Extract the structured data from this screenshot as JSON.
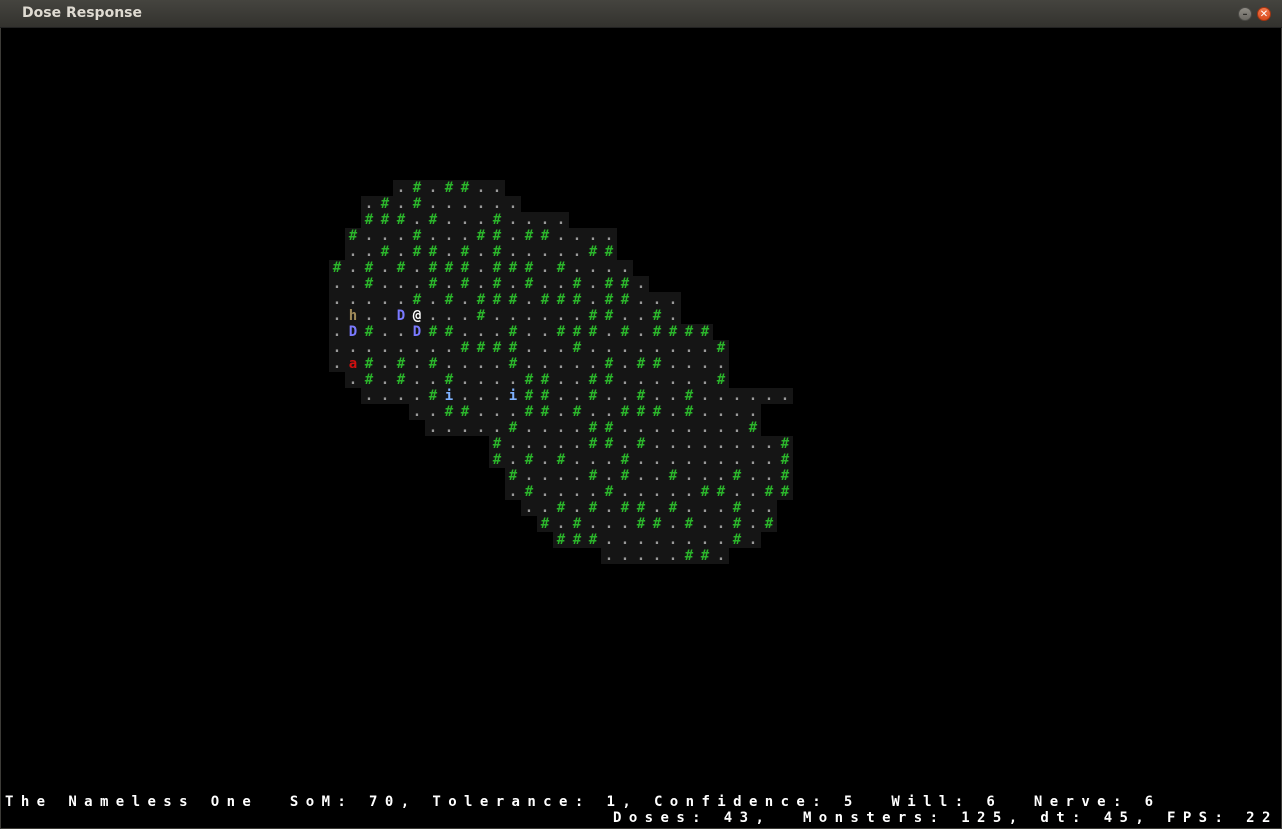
{
  "window": {
    "title": "Dose Response",
    "minimize_icon": "minus-icon",
    "close_icon": "close-icon"
  },
  "colors": {
    "background": "#000000",
    "floor": "#151515",
    "wall_green": "#2bb52b",
    "floor_dot": "#9a9a9a",
    "player": "#ffffff",
    "monster_D": "#7a7aff",
    "monster_h": "#a08b5a",
    "monster_i": "#7fb2ff",
    "monster_a": "#d01010"
  },
  "map": {
    "origin_col": 20,
    "origin_row": 7,
    "rows": [
      {
        "row": 9,
        "start": 24,
        "text": ". # . # # . ."
      },
      {
        "row": 10,
        "start": 22,
        "text": ". # . # . . . . . ."
      },
      {
        "row": 11,
        "start": 22,
        "text": "# # # . # . . . # . . . ."
      },
      {
        "row": 12,
        "start": 21,
        "text": "# . . . # . . . # # . # # . . . ."
      },
      {
        "row": 13,
        "start": 21,
        "text": ". . # . # # . # . # . . . . . # #"
      },
      {
        "row": 14,
        "start": 20,
        "text": "# . # . # . # # # . # # # . # . . . ."
      },
      {
        "row": 15,
        "start": 20,
        "text": ". . # . . . # . # . # . # . . # . # # ."
      },
      {
        "row": 16,
        "start": 20,
        "text": ". . . . . # . # . # # # . # # # . # # . . ."
      },
      {
        "row": 17,
        "start": 20,
        "text": ". h . . D @ . . . # . . . . . . # # . . # ."
      },
      {
        "row": 18,
        "start": 20,
        "text": ". D # . . D # # . . . # . . # # # . # . # # # #"
      },
      {
        "row": 19,
        "start": 20,
        "text": ". . . . . . . . # # # # . . . # . . . . . . . . #"
      },
      {
        "row": 20,
        "start": 20,
        "text": ". a # . # . # . . . . # . . . . . # . # # . . . ."
      },
      {
        "row": 21,
        "start": 21,
        "text": ". # . # . . # . . . . # # . . # # . . . . . . #"
      },
      {
        "row": 22,
        "start": 22,
        "text": ". . . . # i . . . i # # . . # . . # . . # . . . . . ."
      },
      {
        "row": 23,
        "start": 25,
        "text": ". . # # . . . # # . # . . # # # . # . . . ."
      },
      {
        "row": 24,
        "start": 26,
        "text": ". . . . . # . . . . # # . . . . . . . . #"
      },
      {
        "row": 25,
        "start": 30,
        "text": "# . . . . . # # . # . . . . . . . . #"
      },
      {
        "row": 26,
        "start": 30,
        "text": "# . # . # . . . # . . . . . . . . . #"
      },
      {
        "row": 27,
        "start": 31,
        "text": "# . . . . # . # . . # . . . # . . #"
      },
      {
        "row": 28,
        "start": 31,
        "text": ". # . . . . # . . . . . # # . . # #"
      },
      {
        "row": 29,
        "start": 32,
        "text": ". . # . # . # # . # . . . # . ."
      },
      {
        "row": 30,
        "start": 33,
        "text": "# . # . . . # # . # . . # . #"
      },
      {
        "row": 31,
        "start": 34,
        "text": "# # # . . . . . . . . # ."
      },
      {
        "row": 32,
        "start": 37,
        "text": ". . . . . # # ."
      }
    ]
  },
  "status": {
    "line1": "The Nameless One  SoM: 70, Tolerance: 1, Confidence: 5  Will: 6  Nerve: 6",
    "line2": "Doses: 43,  Monsters: 125, dt: 45, FPS: 22"
  }
}
